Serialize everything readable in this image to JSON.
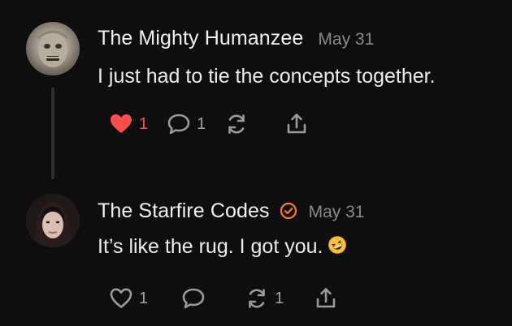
{
  "comments": [
    {
      "author": "The Mighty Humanzee",
      "date": "May 31",
      "text": "I just had to tie the concepts together.",
      "liked": true,
      "likes": "1",
      "replies": "1",
      "restacks": ""
    },
    {
      "author": "The Starfire Codes",
      "date": "May 31",
      "text": "It’s like the rug. I got you.",
      "liked": false,
      "likes": "1",
      "replies": "",
      "restacks": "1"
    }
  ],
  "colors": {
    "like_active": "#ff4d4d",
    "badge": "#ff7a1a",
    "muted": "#8a8a8a"
  }
}
